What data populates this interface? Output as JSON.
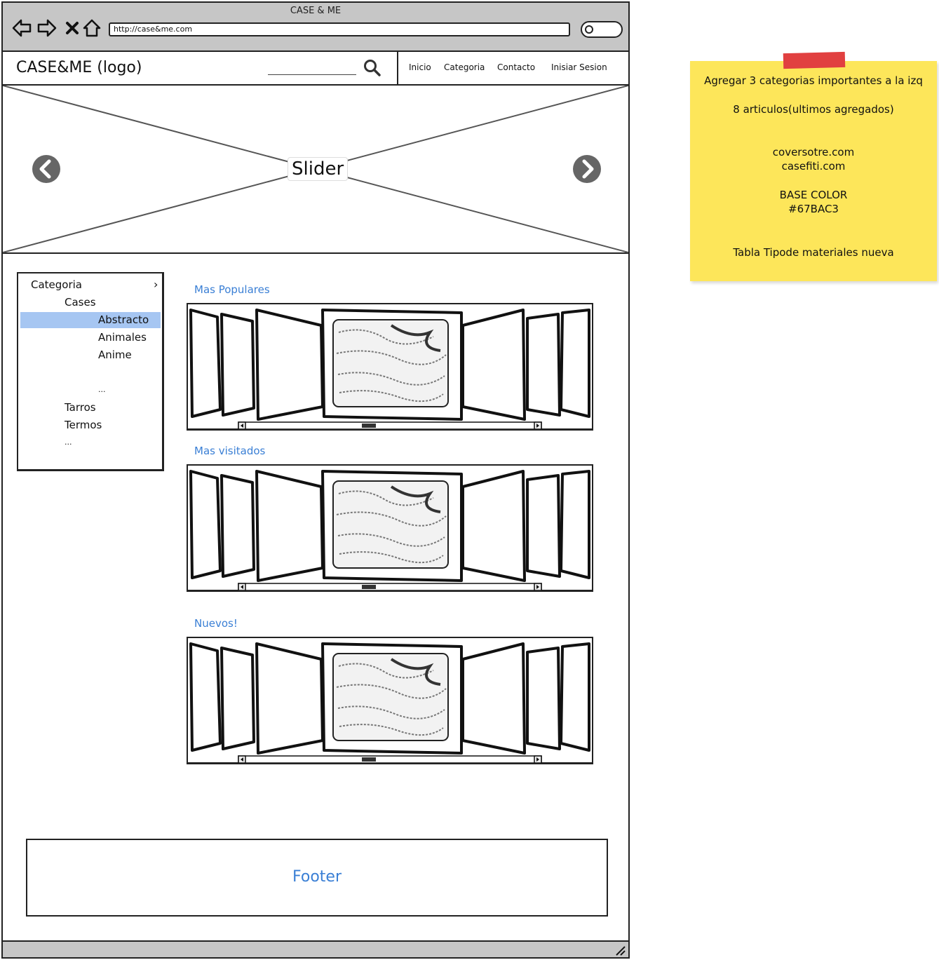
{
  "browser": {
    "window_title": "CASE & ME",
    "url": "http://case&me.com"
  },
  "header": {
    "logo": "CASE&ME (logo)",
    "nav": [
      "Inicio",
      "Categoria",
      "Contacto",
      "Inisiar Sesion"
    ]
  },
  "slider": {
    "label": "Slider"
  },
  "sidebar": {
    "items": [
      "Categoria",
      "Cases",
      "Abstracto",
      "Animales",
      "Anime",
      "...",
      "Tarros",
      "Termos",
      "..."
    ],
    "selected": "Abstracto"
  },
  "carousels": [
    {
      "title": "Mas Populares"
    },
    {
      "title": "Mas visitados"
    },
    {
      "title": "Nuevos!"
    }
  ],
  "footer": {
    "label": "Footer"
  },
  "note": {
    "lines": [
      "Agregar 3 categorias importantes a la izq",
      "8 articulos(ultimos agregados)",
      "coversotre.com",
      "casefiti.com",
      "BASE COLOR",
      "#67BAC3",
      "Tabla Tipode materiales nueva"
    ]
  },
  "colors": {
    "link": "#3a7fd5",
    "selection": "#a6c6f2",
    "note": "#fde65a",
    "tape": "#e14040",
    "chrome": "#c6c6c6"
  }
}
